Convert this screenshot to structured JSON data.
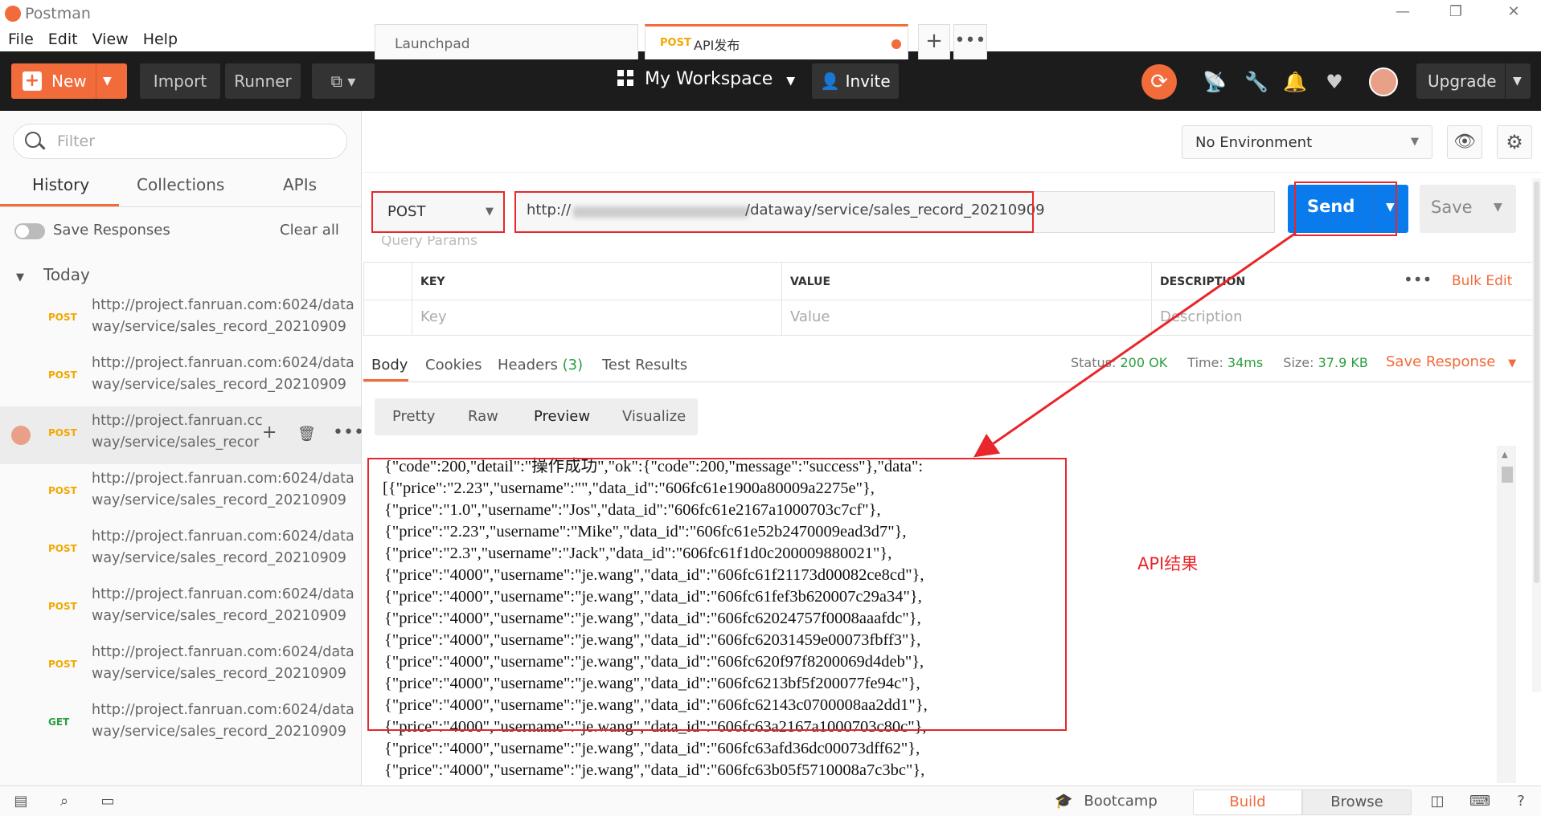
{
  "window": {
    "title": "Postman"
  },
  "menu": [
    "File",
    "Edit",
    "View",
    "Help"
  ],
  "toolbar": {
    "new_label": "New",
    "import_label": "Import",
    "runner_label": "Runner",
    "workspace_label": "My Workspace",
    "invite_label": "Invite",
    "upgrade_label": "Upgrade"
  },
  "sidebar": {
    "filter_placeholder": "Filter",
    "tabs": [
      "History",
      "Collections",
      "APIs"
    ],
    "save_responses_label": "Save Responses",
    "clear_all_label": "Clear all",
    "group_label": "Today",
    "items": [
      {
        "method": "POST",
        "line1": "http://project.fanruan.com:6024/data",
        "line2": "way/service/sales_record_20210909"
      },
      {
        "method": "POST",
        "line1": "http://project.fanruan.com:6024/data",
        "line2": "way/service/sales_record_20210909"
      },
      {
        "method": "POST",
        "line1": "http://project.fanruan.cc",
        "line2": "way/service/sales_recor"
      },
      {
        "method": "POST",
        "line1": "http://project.fanruan.com:6024/data",
        "line2": "way/service/sales_record_20210909"
      },
      {
        "method": "POST",
        "line1": "http://project.fanruan.com:6024/data",
        "line2": "way/service/sales_record_20210909"
      },
      {
        "method": "POST",
        "line1": "http://project.fanruan.com:6024/data",
        "line2": "way/service/sales_record_20210909"
      },
      {
        "method": "POST",
        "line1": "http://project.fanruan.com:6024/data",
        "line2": "way/service/sales_record_20210909"
      },
      {
        "method": "GET",
        "line1": "http://project.fanruan.com:6024/data",
        "line2": "way/service/sales_record_20210909"
      }
    ]
  },
  "tabs": {
    "launchpad_label": "Launchpad",
    "active_method": "POST",
    "active_label": "API发布"
  },
  "environment": {
    "selected": "No Environment"
  },
  "request": {
    "method": "POST",
    "url_prefix": "http://",
    "url_suffix": "/dataway/service/sales_record_20210909",
    "send_label": "Send",
    "save_label": "Save"
  },
  "params": {
    "section_label": "Query Params",
    "headers": [
      "KEY",
      "VALUE",
      "DESCRIPTION"
    ],
    "placeholders": [
      "Key",
      "Value",
      "Description"
    ],
    "bulk_edit_label": "Bulk Edit"
  },
  "response": {
    "tabs": {
      "body": "Body",
      "cookies": "Cookies",
      "headers": "Headers",
      "headers_count": "(3)",
      "test_results": "Test Results"
    },
    "status_label": "Status:",
    "status_value": "200 OK",
    "time_label": "Time:",
    "time_value": "34ms",
    "size_label": "Size:",
    "size_value": "37.9 KB",
    "save_response_label": "Save Response",
    "view_tabs": [
      "Pretty",
      "Raw",
      "Preview",
      "Visualize"
    ],
    "lines": [
      "{\"code\":200,\"detail\":\"操作成功\",\"ok\":{\"code\":200,\"message\":\"success\"},\"data\":",
      "[{\"price\":\"2.23\",\"username\":\"\",\"data_id\":\"606fc61e1900a80009a2275e\"},",
      "{\"price\":\"1.0\",\"username\":\"Jos\",\"data_id\":\"606fc61e2167a1000703c7cf\"},",
      "{\"price\":\"2.23\",\"username\":\"Mike\",\"data_id\":\"606fc61e52b2470009ead3d7\"},",
      "{\"price\":\"2.3\",\"username\":\"Jack\",\"data_id\":\"606fc61f1d0c200009880021\"},",
      "{\"price\":\"4000\",\"username\":\"je.wang\",\"data_id\":\"606fc61f21173d00082ce8cd\"},",
      "{\"price\":\"4000\",\"username\":\"je.wang\",\"data_id\":\"606fc61fef3b620007c29a34\"},",
      "{\"price\":\"4000\",\"username\":\"je.wang\",\"data_id\":\"606fc62024757f0008aaafdc\"},",
      "{\"price\":\"4000\",\"username\":\"je.wang\",\"data_id\":\"606fc62031459e00073fbff3\"},",
      "{\"price\":\"4000\",\"username\":\"je.wang\",\"data_id\":\"606fc620f97f8200069d4deb\"},",
      "{\"price\":\"4000\",\"username\":\"je.wang\",\"data_id\":\"606fc6213bf5f200077fe94c\"},",
      "{\"price\":\"4000\",\"username\":\"je.wang\",\"data_id\":\"606fc62143c0700008aa2dd1\"},",
      "{\"price\":\"4000\",\"username\":\"je.wang\",\"data_id\":\"606fc63a2167a1000703c80c\"},",
      "{\"price\":\"4000\",\"username\":\"je.wang\",\"data_id\":\"606fc63afd36dc00073dff62\"},",
      "{\"price\":\"4000\",\"username\":\"je.wang\",\"data_id\":\"606fc63b05f5710008a7c3bc\"},"
    ]
  },
  "annotation": {
    "label": "API结果"
  },
  "statusbar": {
    "bootcamp_label": "Bootcamp",
    "build_label": "Build",
    "browse_label": "Browse"
  },
  "colors": {
    "accent": "#f26b3a",
    "send_blue": "#097bed",
    "annotation_red": "#e8262b",
    "status_green": "#2a9e3f"
  }
}
